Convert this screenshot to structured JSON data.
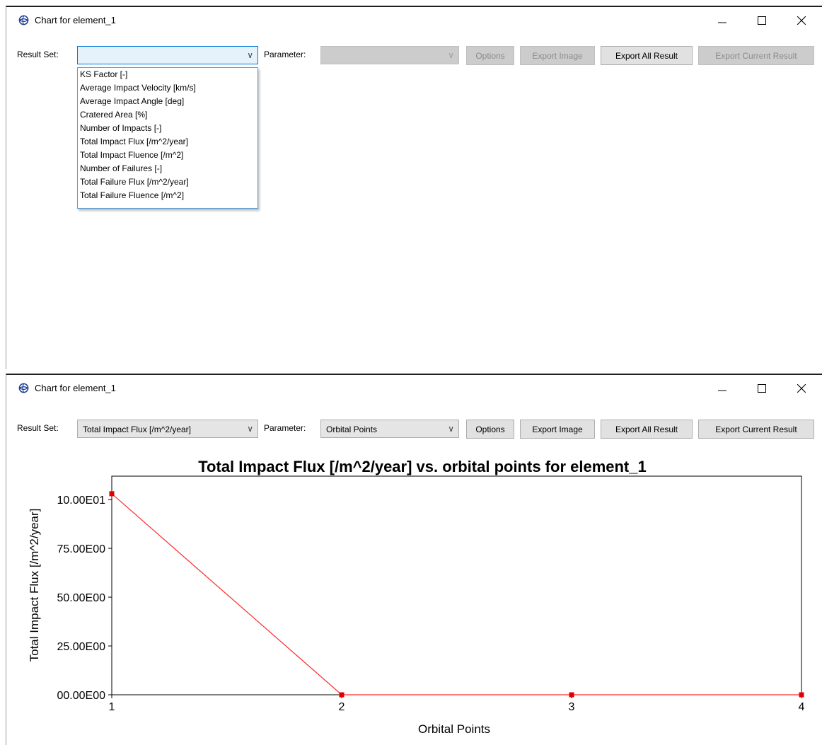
{
  "window_top": {
    "title": "Chart for element_1",
    "toolbar": {
      "result_set_label": "Result Set:",
      "result_set_value": "",
      "parameter_label": "Parameter:",
      "parameter_value": "",
      "options": "Options",
      "export_image": "Export Image",
      "export_all": "Export All Result",
      "export_current": "Export Current Result"
    },
    "dropdown_items": [
      "KS Factor [-]",
      "Average Impact Velocity [km/s]",
      "Average Impact Angle [deg]",
      "Cratered Area [%]",
      "Number of Impacts [-]",
      "Total Impact Flux [/m^2/year]",
      "Total Impact Fluence [/m^2]",
      "Number of Failures [-]",
      "Total Failure Flux [/m^2/year]",
      "Total Failure Fluence [/m^2]"
    ]
  },
  "window_bottom": {
    "title": "Chart for element_1",
    "toolbar": {
      "result_set_label": "Result Set:",
      "result_set_value": "Total Impact Flux [/m^2/year]",
      "parameter_label": "Parameter:",
      "parameter_value": "Orbital Points",
      "options": "Options",
      "export_image": "Export Image",
      "export_all": "Export All Result",
      "export_current": "Export Current Result"
    }
  },
  "icons": {
    "app": "globe-app-icon",
    "minimize": "minimize-icon",
    "maximize": "maximize-icon",
    "close": "close-icon",
    "dropdown": "chevron-down-icon"
  },
  "colors": {
    "series": "#ff2a2a",
    "marker": "#e00000",
    "focus_border": "#0078d7"
  },
  "chart_data": {
    "type": "line",
    "title": "Total Impact Flux [/m^2/year] vs. orbital points for element_1",
    "xlabel": "Orbital Points",
    "ylabel": "Total Impact Flux [/m^2/year]",
    "x": [
      1,
      2,
      3,
      4
    ],
    "series": [
      {
        "values": [
          103,
          0,
          0,
          0
        ]
      }
    ],
    "xlim": [
      1,
      4
    ],
    "ylim": [
      0,
      112
    ],
    "x_ticks": [
      1,
      2,
      3,
      4
    ],
    "y_ticks": [
      0,
      25,
      50,
      75,
      100
    ],
    "y_tick_labels": [
      "00.00E00",
      "25.00E00",
      "50.00E00",
      "75.00E00",
      "10.00E01"
    ],
    "grid": false,
    "legend": "none"
  }
}
